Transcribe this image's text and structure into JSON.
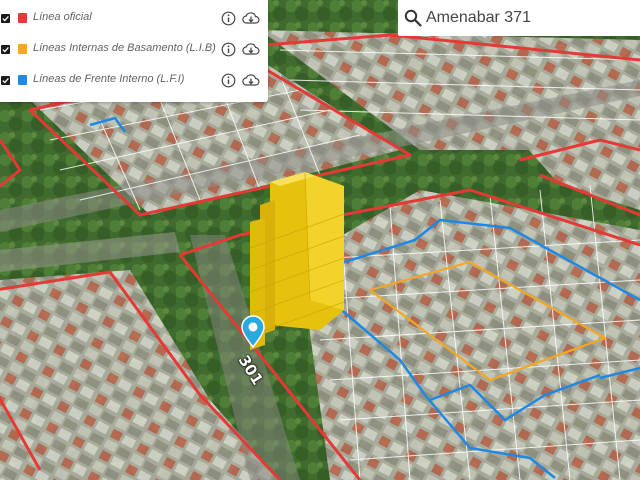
{
  "layers": [
    {
      "label": "Línea oficial",
      "color": "#e53935"
    },
    {
      "label": "Líneas Internas de Basamento (L.I.B)",
      "color": "#f5a623"
    },
    {
      "label": "Líneas de Frente Interno (L.F.I)",
      "color": "#1e88e5"
    }
  ],
  "layer_icons": {
    "info": "info-icon",
    "download": "cloud-download-icon"
  },
  "search": {
    "value": "Amenabar 371",
    "icon": "search-icon"
  },
  "map": {
    "street_number_label": "301",
    "marker_icon": "map-pin-icon",
    "marker_color": "#29a9e0",
    "building_color": "#f0cc10"
  },
  "colors": {
    "line_oficial": "#e53935",
    "lib": "#f5a623",
    "lfi": "#1e88e5"
  }
}
